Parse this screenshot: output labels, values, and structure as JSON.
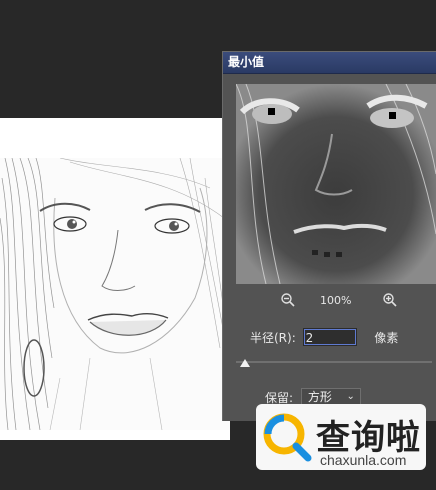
{
  "dialog": {
    "title": "最小值",
    "zoom_level": "100%",
    "radius_label": "半径(R):",
    "radius_value": "2",
    "radius_unit": "像素",
    "radius_slider_level": 0.02,
    "keep_label": "保留:",
    "keep_value": "方形",
    "icons": {
      "zoom_out": "zoom-out-icon",
      "zoom_in": "zoom-in-icon",
      "chevron": "chevron-down-icon",
      "slider": "slider-thumb"
    }
  },
  "watermark": {
    "brand_cn": "查询啦",
    "brand_en": "chaxunla.com"
  },
  "colors": {
    "dialog_bg": "#535353",
    "titlebar": "#2f3f6e",
    "workspace_bg": "#282828",
    "document_bg": "#ffffff",
    "accent_blue": "#1a8fe0"
  }
}
